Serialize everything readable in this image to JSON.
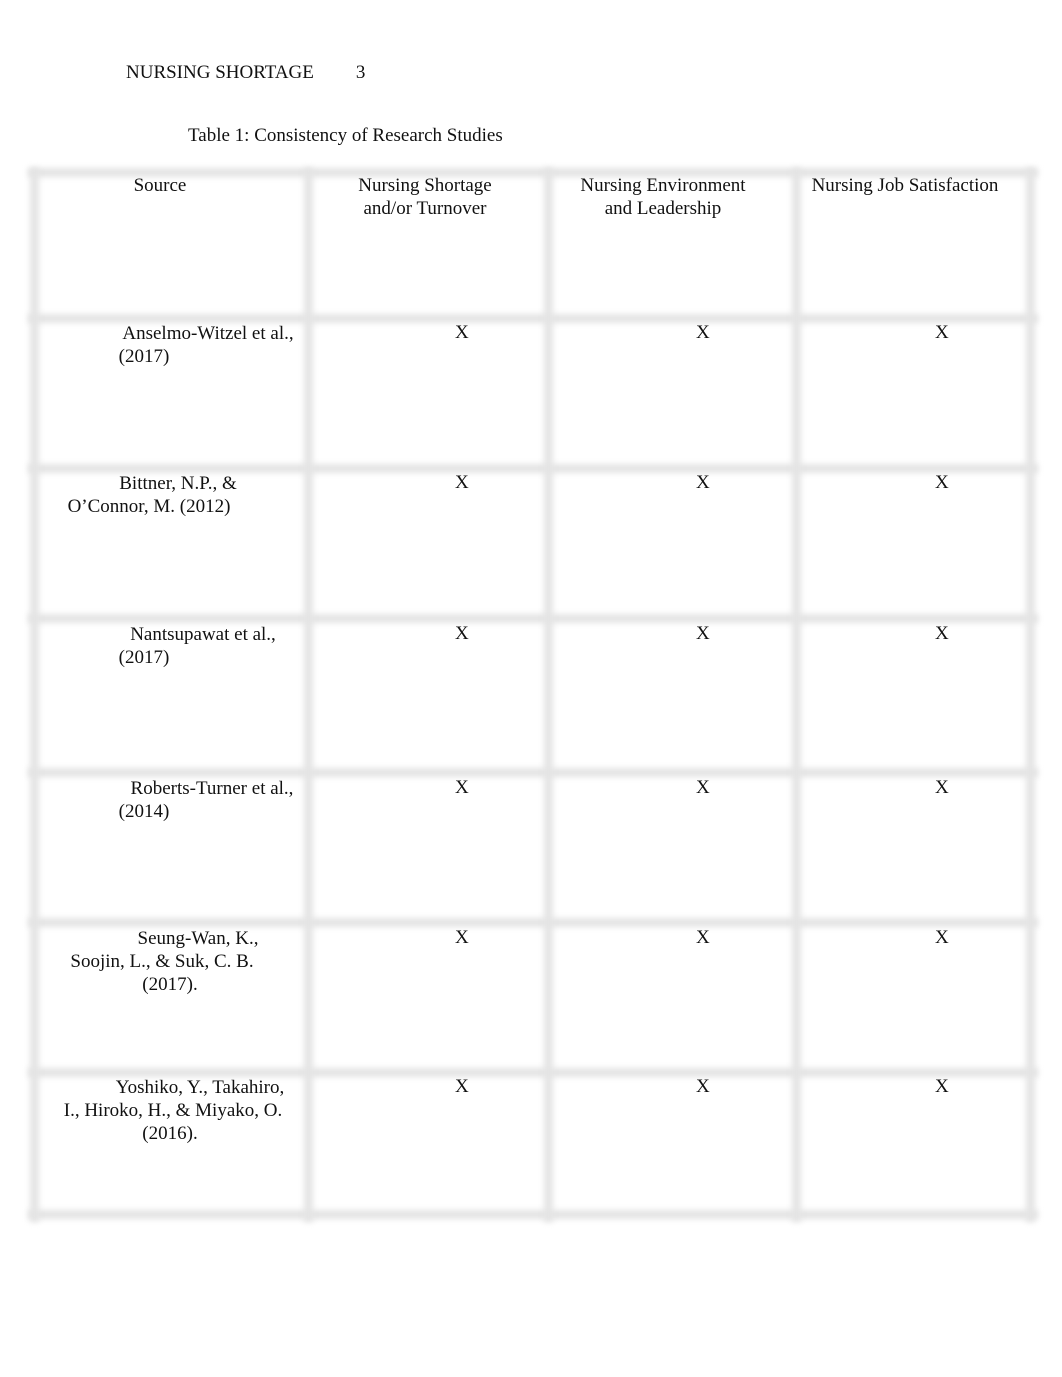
{
  "header": {
    "running_head": "NURSING SHORTAGE",
    "page_number": "3"
  },
  "table": {
    "caption": "Table 1: Consistency of Research Studies",
    "columns": [
      {
        "lines": [
          "Source"
        ]
      },
      {
        "lines": [
          "Nursing Shortage",
          "and/or Turnover"
        ]
      },
      {
        "lines": [
          "Nursing Environment",
          "and Leadership"
        ]
      },
      {
        "lines": [
          "Nursing Job Satisfaction"
        ]
      }
    ],
    "rows": [
      {
        "source_lines": [
          "Anselmo-Witzel et al.,",
          "(2017)"
        ],
        "marks": [
          "X",
          "X",
          "X"
        ]
      },
      {
        "source_lines": [
          "Bittner, N.P., &",
          "O’Connor, M. (2012)"
        ],
        "marks": [
          "X",
          "X",
          "X"
        ]
      },
      {
        "source_lines": [
          "Nantsupawat et al.,",
          "(2017)"
        ],
        "marks": [
          "X",
          "X",
          "X"
        ]
      },
      {
        "source_lines": [
          "Roberts-Turner et al.,",
          "(2014)"
        ],
        "marks": [
          "X",
          "X",
          "X"
        ]
      },
      {
        "source_lines": [
          "Seung-Wan, K.,",
          "Soojin, L., & Suk, C. B.",
          "(2017)."
        ],
        "marks": [
          "X",
          "X",
          "X"
        ]
      },
      {
        "source_lines": [
          "Yoshiko, Y., Takahiro,",
          "I., Hiroko, H., & Miyako, O.",
          "(2016)."
        ],
        "marks": [
          "X",
          "X",
          "X"
        ]
      }
    ]
  }
}
